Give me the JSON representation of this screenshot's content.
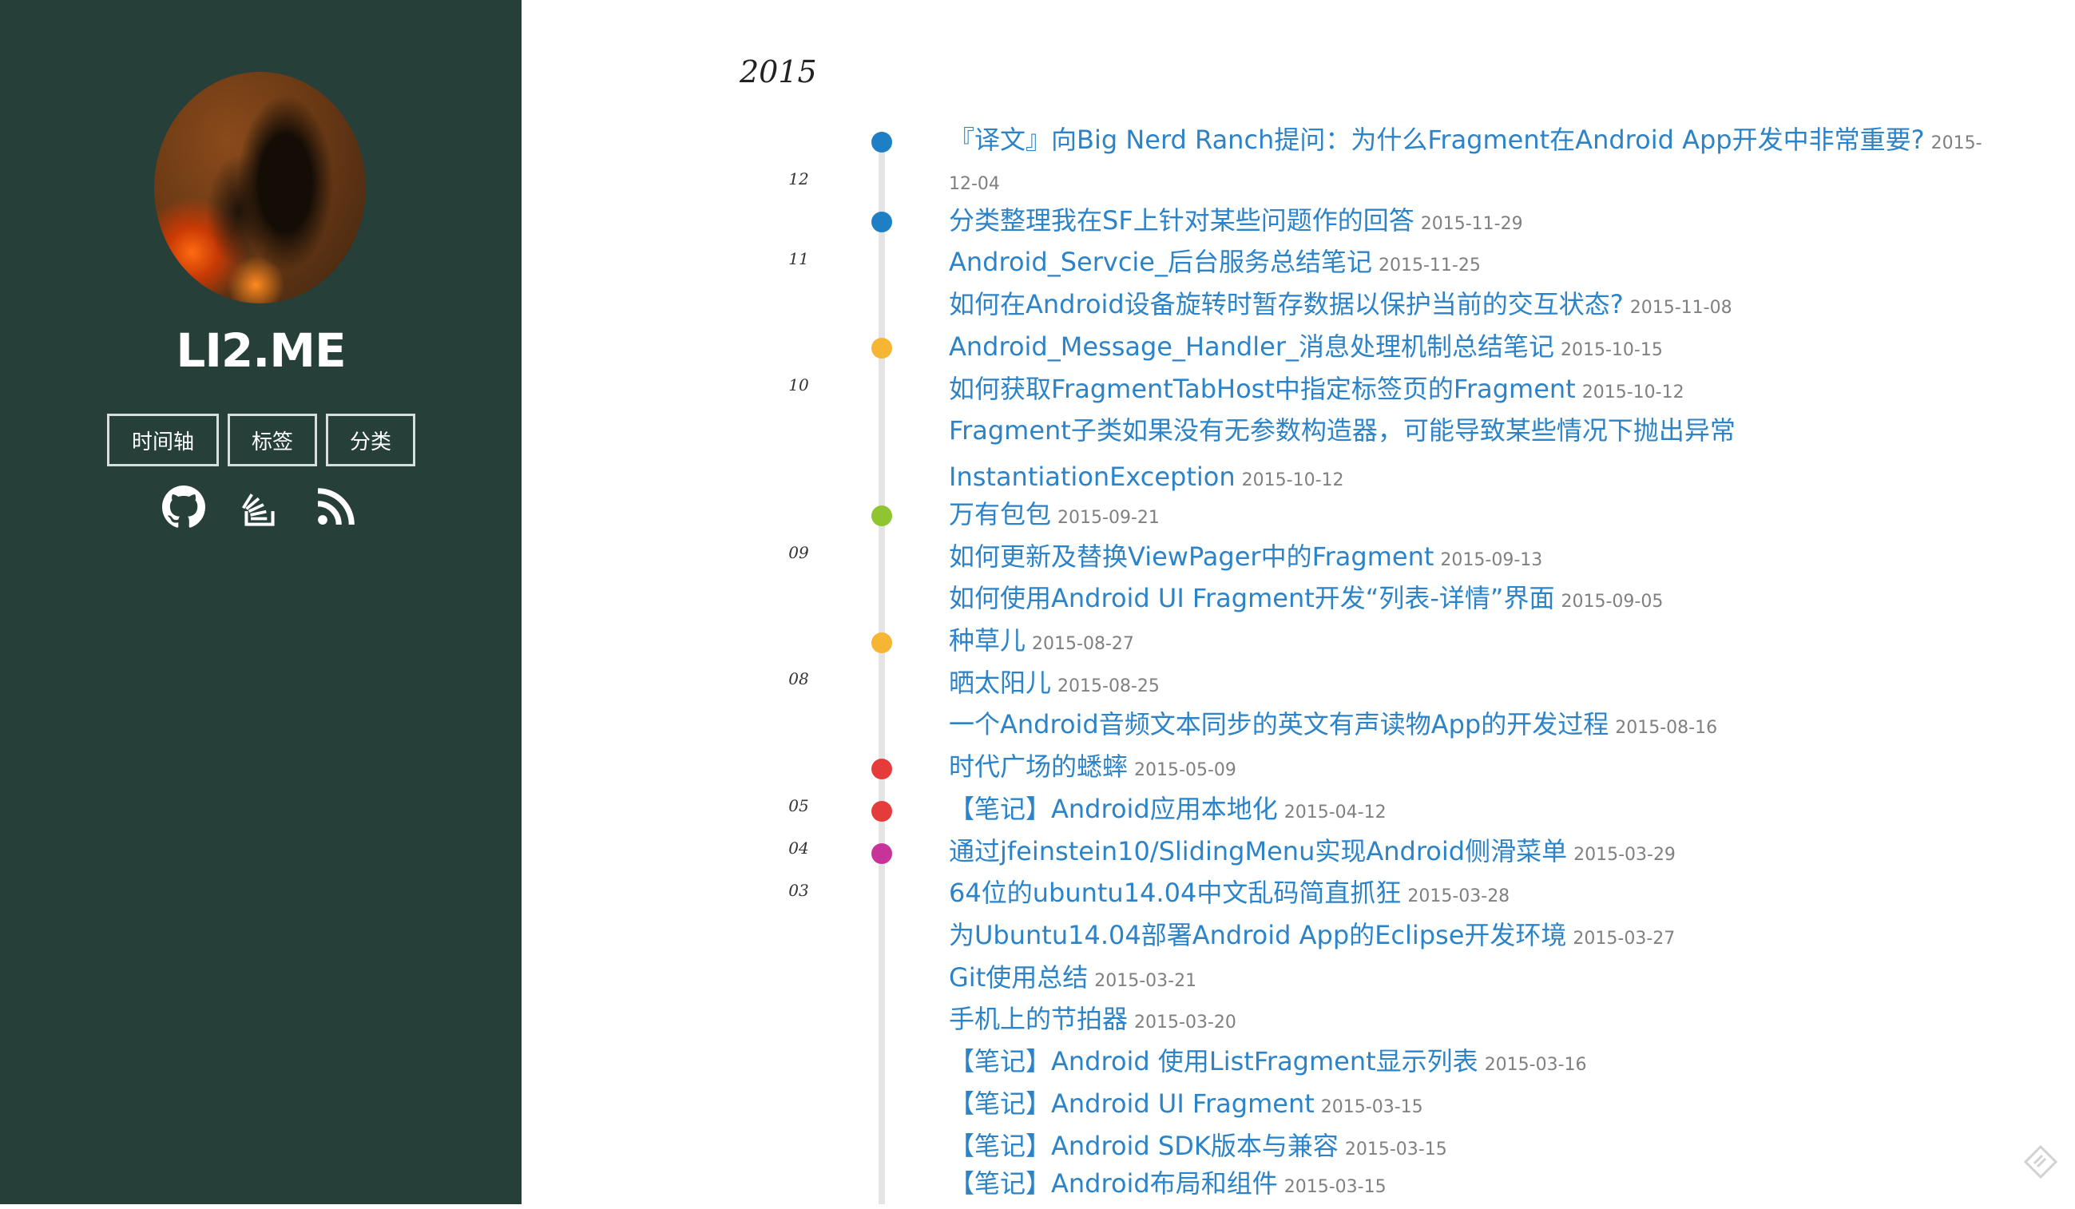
{
  "site": {
    "title": "LI2.ME",
    "nav": [
      "时间轴",
      "标签",
      "分类"
    ],
    "social_icons": [
      "github-icon",
      "stackoverflow-icon",
      "rss-icon"
    ]
  },
  "timeline": {
    "year": "2015",
    "months": [
      "12",
      "11",
      "10",
      "09",
      "08",
      "05",
      "04",
      "03"
    ],
    "dot_colors": {
      "12": "#1f7fc4",
      "11": "#1f7fc4",
      "10": "#f6b532",
      "09": "#8ec530",
      "08": "#f6b532",
      "05": "#e63b3b",
      "04": "#c8339a"
    },
    "posts": [
      {
        "title": "『译文』向Big Nerd Ranch提问：为什么Fragment在Android App开发中非常重要?",
        "date": "2015-12-04"
      },
      {
        "title": "分类整理我在SF上针对某些问题作的回答",
        "date": "2015-11-29"
      },
      {
        "title": "Android_Servcie_后台服务总结笔记",
        "date": "2015-11-25"
      },
      {
        "title": "如何在Android设备旋转时暂存数据以保护当前的交互状态?",
        "date": "2015-11-08"
      },
      {
        "title": "Android_Message_Handler_消息处理机制总结笔记",
        "date": "2015-10-15"
      },
      {
        "title": "如何获取FragmentTabHost中指定标签页的Fragment",
        "date": "2015-10-12"
      },
      {
        "title": "Fragment子类如果没有无参数构造器，可能导致某些情况下抛出异常 InstantiationException",
        "date": "2015-10-12"
      },
      {
        "title": "万有包包",
        "date": "2015-09-21"
      },
      {
        "title": "如何更新及替换ViewPager中的Fragment",
        "date": "2015-09-13"
      },
      {
        "title": "如何使用Android UI Fragment开发“列表-详情”界面",
        "date": "2015-09-05"
      },
      {
        "title": "种草儿",
        "date": "2015-08-27"
      },
      {
        "title": "晒太阳儿",
        "date": "2015-08-25"
      },
      {
        "title": "一个Android音频文本同步的英文有声读物App的开发过程",
        "date": "2015-08-16"
      },
      {
        "title": "时代广场的蟋蟀",
        "date": "2015-05-09"
      },
      {
        "title": "【笔记】Android应用本地化",
        "date": "2015-04-12"
      },
      {
        "title": "通过jfeinstein10/SlidingMenu实现Android侧滑菜单",
        "date": "2015-03-29"
      },
      {
        "title": "64位的ubuntu14.04中文乱码简直抓狂",
        "date": "2015-03-28"
      },
      {
        "title": "为Ubuntu14.04部署Android App的Eclipse开发环境",
        "date": "2015-03-27"
      },
      {
        "title": "Git使用总结",
        "date": "2015-03-21"
      },
      {
        "title": "手机上的节拍器",
        "date": "2015-03-20"
      },
      {
        "title": "【笔记】Android 使用ListFragment显示列表",
        "date": "2015-03-16"
      },
      {
        "title": "【笔记】Android UI Fragment",
        "date": "2015-03-15"
      },
      {
        "title": "【笔记】Android SDK版本与兼容",
        "date": "2015-03-15"
      },
      {
        "title": "【笔记】Android布局和组件",
        "date": "2015-03-15"
      }
    ]
  }
}
